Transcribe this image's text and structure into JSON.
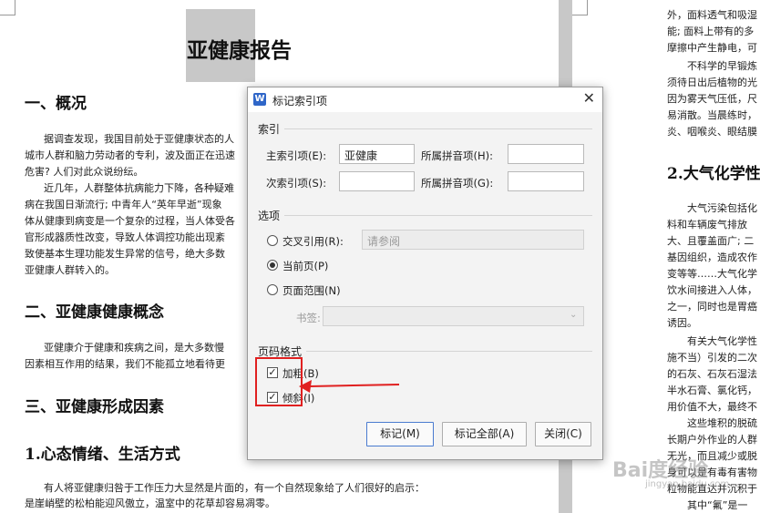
{
  "document": {
    "title": "亚健康报告",
    "sections": {
      "s1": "一、概况",
      "s2": "二、亚健康健康概念",
      "s3": "三、亚健康形成因素",
      "s4": "1.心态情绪、生活方式",
      "r2": "2.大气化学性"
    },
    "left_lines": [
      "据调查发现，我国目前处于亚健康状态的人",
      "城市人群和脑力劳动者的专利，波及面正在迅速",
      "危害? 人们对此众说纷纭。",
      "近几年，人群整体抗病能力下降，各种疑难",
      "病在我国日渐流行; 中青年人“英年早逝”现象",
      "体从健康到病变是一个复杂的过程，当人体受各",
      "官形成器质性改变，导致人体调控功能出现紊",
      "致使基本生理功能发生异常的信号，绝大多数",
      "亚健康人群转入的。",
      "亚健康介于健康和疾病之间，是大多数慢",
      "因素相互作用的结果，我们不能孤立地看待更",
      "有人将亚健康归咎于工作压力大显然是片面的，有一个自然现象给了人们很好的启示：",
      "是崖峭壁的松柏能迎风傲立，温室中的花草却容易凋零。"
    ],
    "right_lines": [
      "外，面料透气和吸湿",
      "能; 面料上带有的多",
      "摩擦中产生静电，可",
      "不科学的早锻炼",
      "须待日出后植物的光",
      "因为雾天气压低，尺",
      "易消散。当晨练时，",
      "炎、咽喉炎、眼结膜",
      "大气污染包括化",
      "料和车辆废气排放",
      "大、且覆盖面广; 二",
      "基因组织，造成农作",
      "变等等……大气化学",
      "饮水间接进入人体，",
      "之一，同时也是胃癌",
      "诱因。",
      "有关大气化学性",
      "施不当）引发的二次",
      "的石灰、石灰石湿法",
      "半水石膏、氯化钙，",
      "用价值不大，最终不",
      "这些堆积的脱硫",
      "长期户外作业的人群",
      "无光，而且减少或脱",
      "身可以是有毒有害物",
      "粒物能直达并沉积于",
      "其中“氟”是一"
    ]
  },
  "dialog": {
    "title": "标记索引项",
    "close_icon": "close-icon",
    "index_section": "索引",
    "main_entry_label": "主索引项(E):",
    "main_entry_value": "亚健康",
    "main_pinyin_label": "所属拼音项(H):",
    "main_pinyin_value": "",
    "sub_entry_label": "次索引项(S):",
    "sub_entry_value": "",
    "sub_pinyin_label": "所属拼音项(G):",
    "sub_pinyin_value": "",
    "options_section": "选项",
    "cross_ref_label": "交叉引用(R):",
    "cross_ref_placeholder": "请参阅",
    "current_page_label": "当前页(P)",
    "page_range_label": "页面范围(N)",
    "bookmark_label": "书签:",
    "page_format_section": "页码格式",
    "bold_label": "加粗(B)",
    "italic_label": "倾斜(I)",
    "mark_button": "标记(M)",
    "mark_all_button": "标记全部(A)",
    "close_button": "关闭(C)"
  },
  "watermark": {
    "text": "Bai度经验",
    "sub": "jingyan.baidu.com"
  },
  "colors": {
    "annotation_red": "#e02020",
    "accent_blue": "#2f66c8"
  }
}
